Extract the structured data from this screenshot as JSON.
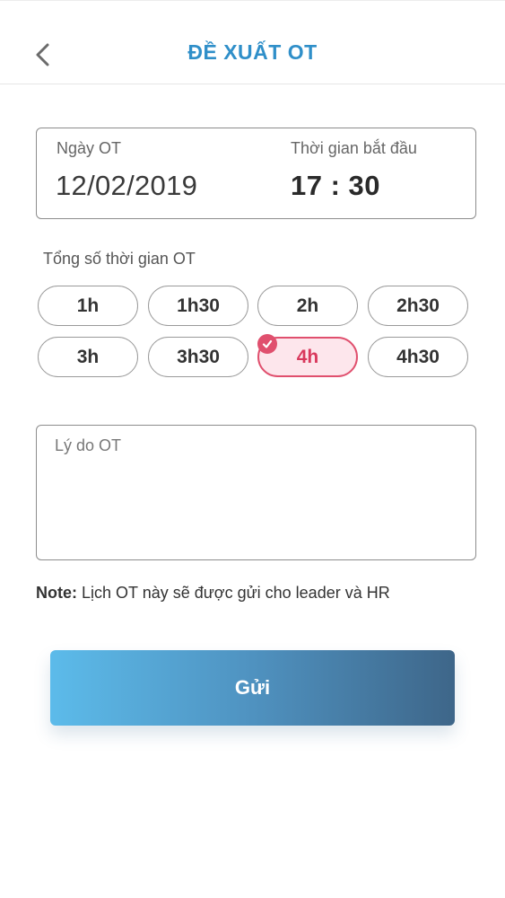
{
  "header": {
    "title": "ĐỀ XUẤT OT",
    "back_icon": "chevron-left-icon",
    "title_color": "#2f8fc9"
  },
  "ot_info": {
    "date_label": "Ngày OT",
    "date_value": "12/02/2019",
    "start_label": "Thời gian bắt đầu",
    "start_value": "17 : 30"
  },
  "duration": {
    "label": "Tổng số thời gian OT",
    "options": [
      "1h",
      "1h30",
      "2h",
      "2h30",
      "3h",
      "3h30",
      "4h",
      "4h30"
    ],
    "selected": "4h",
    "selected_color": "#e0506e",
    "check_icon": "check-circle-icon"
  },
  "reason": {
    "placeholder": "Lý do OT",
    "value": ""
  },
  "note": {
    "prefix": "Note:",
    "text": " Lịch OT này sẽ được gửi cho leader và HR"
  },
  "submit": {
    "label": "Gửi"
  }
}
